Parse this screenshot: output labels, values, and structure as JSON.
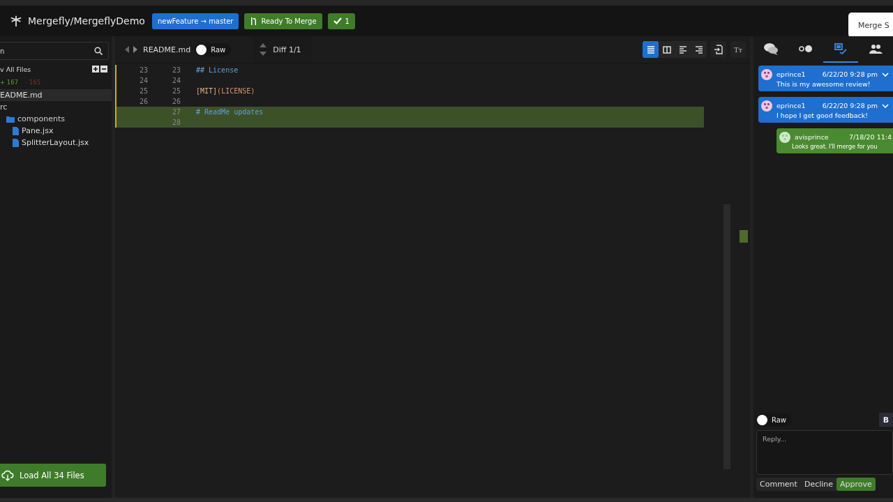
{
  "header": {
    "repo": "Mergefly/MergeflyDemo",
    "branch": "newFeature → master",
    "status": "Ready To Merge",
    "approvals": "1",
    "popup": "Merge S"
  },
  "sidebar": {
    "search": {
      "value": "n"
    },
    "view_all": "v All Files",
    "added": "+ 167",
    "removed": "- 165",
    "tree": [
      {
        "label": "EADME.md",
        "kind": "file",
        "selected": true
      },
      {
        "label": "rc",
        "kind": "folder",
        "selected": false,
        "children": [
          {
            "label": "components",
            "kind": "folder",
            "selected": false,
            "children": [
              {
                "label": "Pane.jsx",
                "kind": "file",
                "selected": false
              },
              {
                "label": "SplitterLayout.jsx",
                "kind": "file",
                "selected": false
              }
            ]
          }
        ]
      }
    ],
    "load_button": "Load All 34 Files"
  },
  "editor": {
    "file": "README.md",
    "raw_toggle": {
      "label": "Raw",
      "on": false
    },
    "diff": "Diff 1/1",
    "view_modes": [
      {
        "kind": "unified",
        "selected": true
      },
      {
        "kind": "split",
        "selected": false
      },
      {
        "kind": "left",
        "selected": false
      },
      {
        "kind": "right",
        "selected": false
      }
    ],
    "font_button": "Tт",
    "lines": [
      {
        "old": "23",
        "new": "23",
        "kind": "context",
        "segments": [
          {
            "text": "## License",
            "kind": "heading"
          }
        ]
      },
      {
        "old": "24",
        "new": "24",
        "kind": "context"
      },
      {
        "old": "25",
        "new": "25",
        "kind": "context",
        "segments": [
          {
            "text": "[MIT]",
            "kind": "link"
          },
          {
            "text": "(LICENSE)",
            "kind": "url"
          }
        ]
      },
      {
        "old": "26",
        "new": "26",
        "kind": "context"
      },
      {
        "new": "27",
        "kind": "added",
        "segments": [
          {
            "text": "# ReadMe updates",
            "kind": "heading"
          }
        ]
      },
      {
        "new": "28",
        "kind": "added"
      }
    ]
  },
  "review": {
    "tabs": [
      {
        "kind": "comments",
        "selected": false
      },
      {
        "kind": "commits",
        "selected": false
      },
      {
        "kind": "review",
        "selected": true
      },
      {
        "kind": "people",
        "selected": false
      }
    ],
    "comments": [
      {
        "kind": "review",
        "color": "#1e6fcf",
        "author": "eprince1",
        "time": "6/22/20 9:28 pm",
        "text": "This is my awesome review!"
      },
      {
        "kind": "review",
        "color": "#1e6fcf",
        "author": "eprince1",
        "time": "6/22/20 9:28 pm",
        "text": "I hope I get good feedback!"
      },
      {
        "kind": "reply",
        "color": "#4a8a30",
        "author": "avisprince",
        "time": "7/18/20 11:4",
        "text": "Looks great. I'll merge for you"
      }
    ],
    "raw_toggle": {
      "label": "Raw",
      "on": false
    },
    "bold_button": "B",
    "reply": {
      "placeholder": "Reply..."
    },
    "actions": [
      {
        "label": "Comment",
        "selected": false
      },
      {
        "label": "Decline",
        "selected": false
      },
      {
        "label": "Approve",
        "selected": true
      }
    ]
  }
}
